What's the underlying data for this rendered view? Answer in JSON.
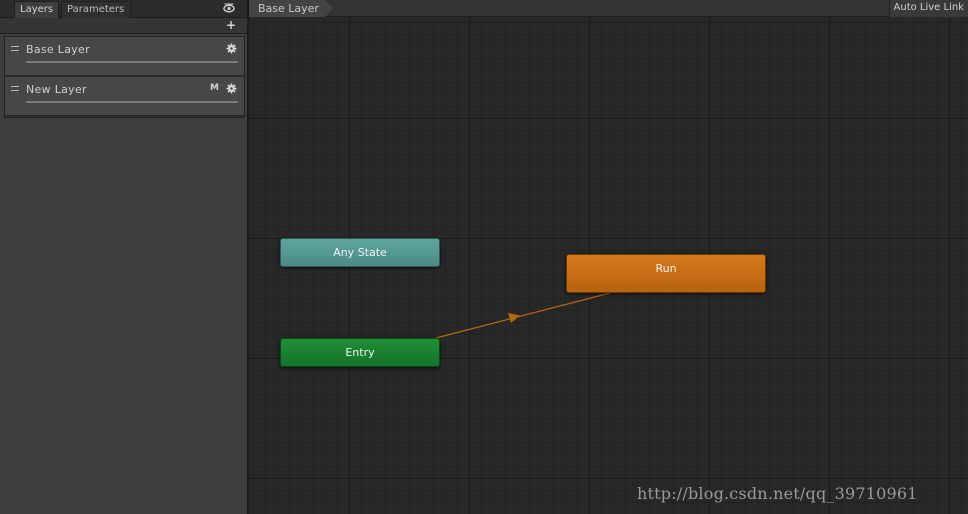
{
  "left_panel": {
    "tabs": [
      {
        "label": "Layers",
        "active": true
      },
      {
        "label": "Parameters",
        "active": false
      }
    ],
    "visibility_icon": "eye-icon",
    "add_button": "+",
    "layers": [
      {
        "name": "Base Layer",
        "mask": "",
        "settings_icon": "gear-icon"
      },
      {
        "name": "New Layer",
        "mask": "M",
        "settings_icon": "gear-icon"
      }
    ]
  },
  "graph": {
    "breadcrumb": "Base Layer",
    "auto_live_link": "Auto Live Link",
    "states": {
      "any_state": {
        "label": "Any State",
        "color": "#559b93"
      },
      "entry": {
        "label": "Entry",
        "color": "#1a8230"
      },
      "run": {
        "label": "Run",
        "color": "#c96f16"
      }
    },
    "transition": {
      "from": "Entry",
      "to": "Run",
      "color": "#b26a10"
    }
  },
  "watermark": "http://blog.csdn.net/qq_39710961"
}
